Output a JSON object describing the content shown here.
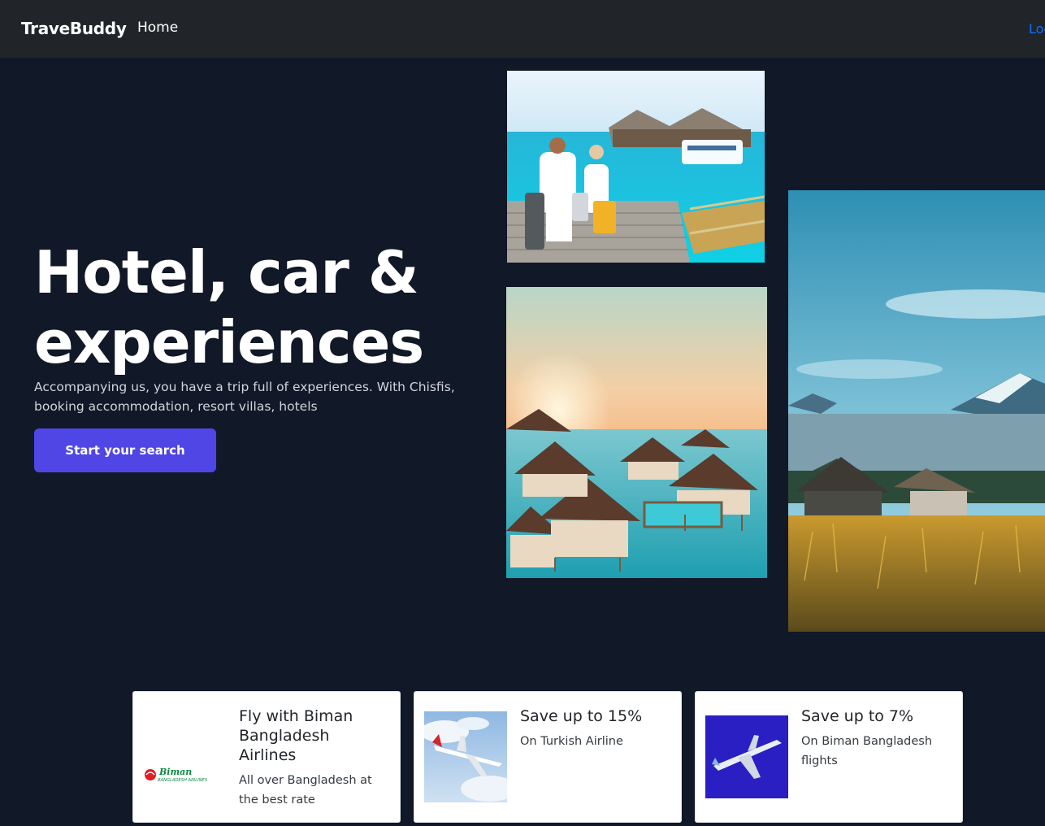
{
  "nav": {
    "brand": "TraveBuddy",
    "home": "Home",
    "login": "Log"
  },
  "hero": {
    "title": "Hotel, car & experiences",
    "subtitle": "Accompanying us, you have a trip full of experiences. With Chisfis, booking accommodation, resort villas, hotels",
    "cta": "Start your search"
  },
  "colors": {
    "background": "#111827",
    "navbar": "#212529",
    "accent": "#4f46e5",
    "link": "#0d6efd"
  },
  "cards": [
    {
      "title": "Fly with Biman Bangladesh Airlines",
      "text": "All over Bangladesh at the best rate",
      "logo_word": "Biman",
      "logo_sub": "BANGLADESH AIRLINES"
    },
    {
      "title": "Save up to 15%",
      "text": "On Turkish Airline"
    },
    {
      "title": "Save up to 7%",
      "text": "On Biman Bangladesh flights"
    }
  ]
}
